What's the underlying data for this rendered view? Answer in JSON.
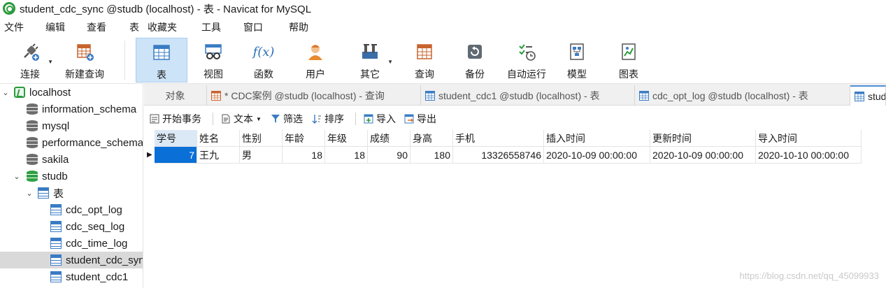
{
  "window": {
    "title": "student_cdc_sync @studb (localhost) - 表 - Navicat for MySQL"
  },
  "menu": [
    "文件",
    "编辑",
    "查看",
    "表",
    "收藏夹",
    "工具",
    "窗口",
    "帮助"
  ],
  "toolbar": [
    {
      "label": "连接",
      "icon": "connect-icon"
    },
    {
      "label": "新建查询",
      "icon": "new-query-icon"
    },
    {
      "label": "表",
      "icon": "table-icon"
    },
    {
      "label": "视图",
      "icon": "view-icon"
    },
    {
      "label": "函数",
      "icon": "function-icon",
      "glyph": "f(x)"
    },
    {
      "label": "用户",
      "icon": "user-icon"
    },
    {
      "label": "其它",
      "icon": "tools-icon"
    },
    {
      "label": "查询",
      "icon": "query-icon"
    },
    {
      "label": "备份",
      "icon": "backup-icon"
    },
    {
      "label": "自动运行",
      "icon": "automation-icon"
    },
    {
      "label": "模型",
      "icon": "model-icon"
    },
    {
      "label": "图表",
      "icon": "chart-icon"
    }
  ],
  "sidebar": {
    "items": [
      {
        "label": "localhost",
        "type": "connection"
      },
      {
        "label": "information_schema",
        "type": "db"
      },
      {
        "label": "mysql",
        "type": "db"
      },
      {
        "label": "performance_schema",
        "type": "db"
      },
      {
        "label": "sakila",
        "type": "db"
      },
      {
        "label": "studb",
        "type": "db-open"
      },
      {
        "label": "表",
        "type": "tables-folder"
      },
      {
        "label": "cdc_opt_log",
        "type": "table"
      },
      {
        "label": "cdc_seq_log",
        "type": "table"
      },
      {
        "label": "cdc_time_log",
        "type": "table"
      },
      {
        "label": "student_cdc_sync",
        "type": "table",
        "selected": true
      },
      {
        "label": "student_cdc1",
        "type": "table"
      }
    ]
  },
  "tabs": [
    {
      "label": "对象"
    },
    {
      "label": "* CDC案例 @studb (localhost) - 查询"
    },
    {
      "label": "student_cdc1 @studb (localhost) - 表"
    },
    {
      "label": "cdc_opt_log @studb (localhost) - 表"
    },
    {
      "label": "student_cdc_sync @studb (localhost) - 表"
    }
  ],
  "subtoolbar": {
    "begin_transaction": "开始事务",
    "text": "文本",
    "filter": "筛选",
    "sort": "排序",
    "import": "导入",
    "export": "导出"
  },
  "grid": {
    "columns": [
      "学号",
      "姓名",
      "性别",
      "年龄",
      "年级",
      "成绩",
      "身高",
      "手机",
      "插入时间",
      "更新时间",
      "导入时间"
    ],
    "rows": [
      [
        "7",
        "王九",
        "男",
        "18",
        "18",
        "90",
        "180",
        "13326558746",
        "2020-10-09 00:00:00",
        "2020-10-09 00:00:00",
        "2020-10-10 00:00:00"
      ]
    ]
  },
  "watermark": "https://blog.csdn.net/qq_45099933",
  "colors": {
    "accent": "#0a6fd6",
    "selected_tool": "#cde3f7",
    "brand_green": "#2b9a3c"
  }
}
